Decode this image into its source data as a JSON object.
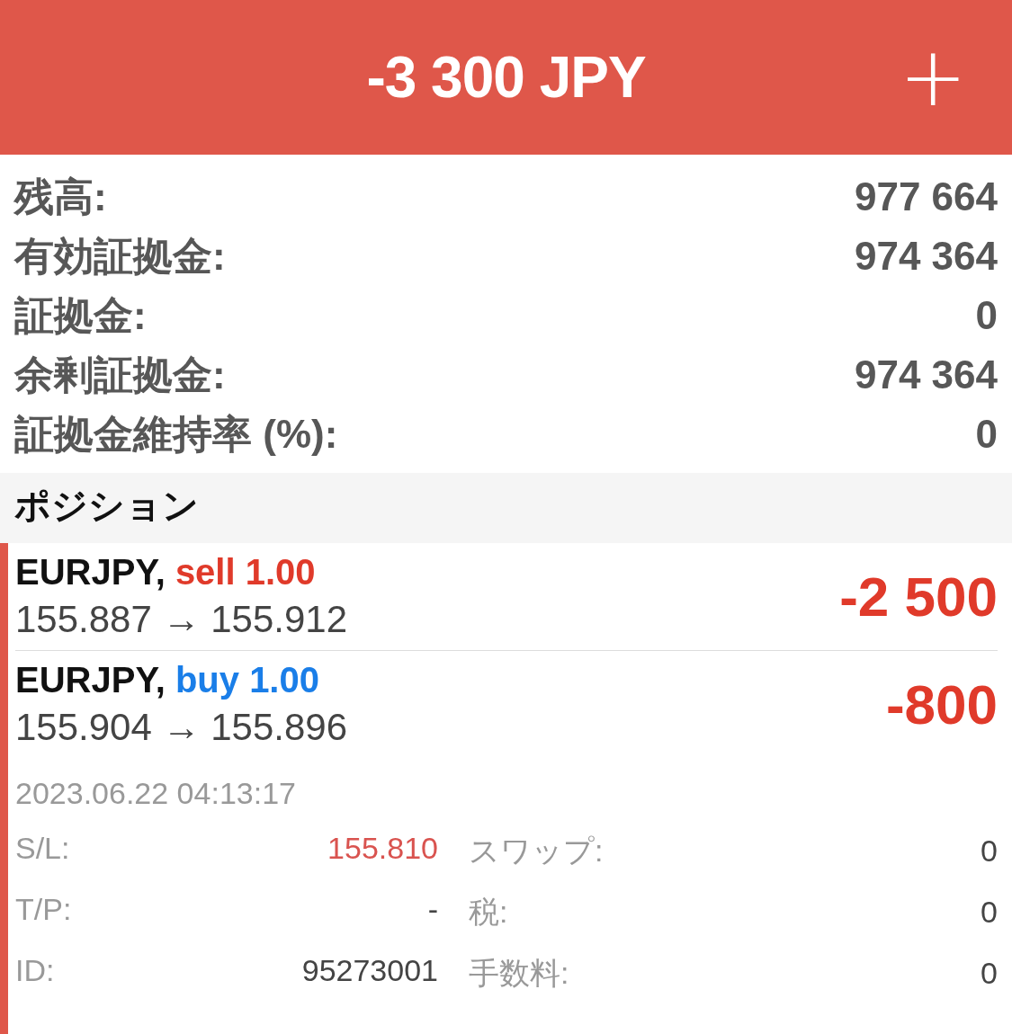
{
  "header": {
    "title": "-3 300 JPY",
    "add_button": "+"
  },
  "summary": [
    {
      "label": "残高:",
      "value": "977 664"
    },
    {
      "label": "有効証拠金:",
      "value": "974 364"
    },
    {
      "label": "証拠金:",
      "value": "0"
    },
    {
      "label": "余剰証拠金:",
      "value": "974 364"
    },
    {
      "label": "証拠金維持率 (%):",
      "value": "0"
    }
  ],
  "section_title": "ポジション",
  "positions": [
    {
      "symbol": "EURJPY,",
      "side": "sell",
      "lots": "1.00",
      "open_price": "155.887",
      "arrow": "→",
      "current_price": "155.912",
      "profit": "-2 500",
      "expanded": false
    },
    {
      "symbol": "EURJPY,",
      "side": "buy",
      "lots": "1.00",
      "open_price": "155.904",
      "arrow": "→",
      "current_price": "155.896",
      "profit": "-800",
      "expanded": true,
      "time": "2023.06.22 04:13:17",
      "details": [
        {
          "label": "S/L:",
          "value": "155.810",
          "highlight": true
        },
        {
          "label": "スワップ:",
          "value": "0",
          "highlight": false
        },
        {
          "label": "T/P:",
          "value": "-",
          "highlight": false
        },
        {
          "label": "税:",
          "value": "0",
          "highlight": false
        },
        {
          "label": "ID:",
          "value": "95273001",
          "highlight": false
        },
        {
          "label": "手数料:",
          "value": "0",
          "highlight": false
        }
      ]
    }
  ]
}
